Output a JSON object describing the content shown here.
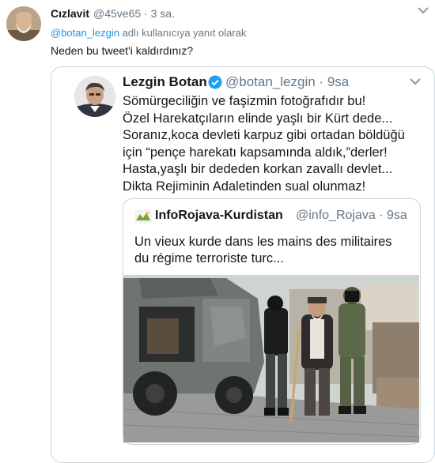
{
  "reply_tweet": {
    "author_name": "Cızlavit",
    "author_handle": "@45ve65",
    "separator": "·",
    "time": "3 sa.",
    "reply_mention": "@botan_lezgin",
    "reply_suffix": "adlı kullanıcıya yanıt olarak",
    "text": "Neden bu tweet'i kaldırdınız?",
    "avatar_icon": "user-photo",
    "menu_icon": "chevron-down-icon"
  },
  "quoted_tweet": {
    "author_name": "Lezgin Botan",
    "verified_icon": "verified-badge-icon",
    "author_handle": "@botan_lezgin",
    "separator": "·",
    "time": "9sa",
    "text_lines": [
      "Sömürgeciliğin ve faşizmin fotoğrafıdır bu!",
      "Özel Harekatçıların elinde yaşlı bir Kürt dede...",
      "Soranız,koca devleti karpuz gibi ortadan böldüğü",
      "için “pençe harekatı kapsamında aldık,”derler!",
      "Hasta,yaşlı bir dededen korkan zavallı devlet...",
      "Dikta Rejiminin Adaletinden sual olunmaz!"
    ],
    "menu_icon": "chevron-down-icon"
  },
  "inner_tweet": {
    "author_name": "InfoRojava-Kurdistan",
    "author_handle": "@info_Rojava",
    "separator": "·",
    "time": "9sa",
    "text_lines": [
      "Un vieux kurde dans les mains des militaires",
      "du régime terroriste turc..."
    ],
    "logo_icon": "inforojava-logo-icon"
  },
  "colors": {
    "link": "#1b95e0",
    "verified": "#1da1f2",
    "secondary_text": "#657786",
    "border": "#ccd6dd"
  }
}
